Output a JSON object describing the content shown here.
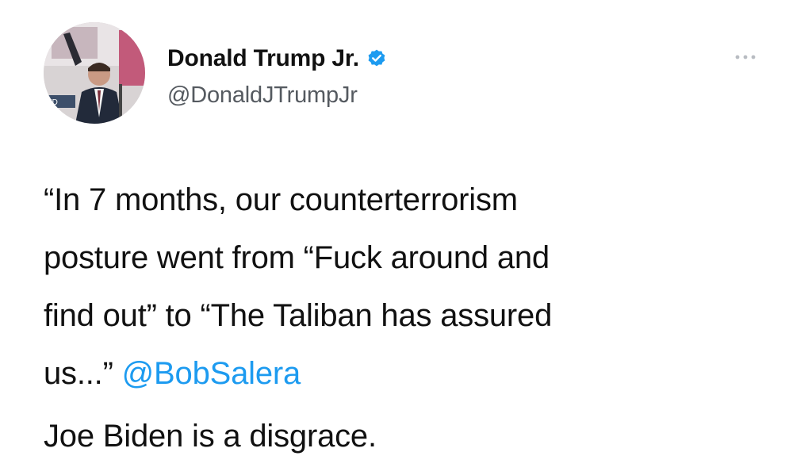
{
  "author": {
    "display_name": "Donald Trump Jr.",
    "handle": "@DonaldJTrumpJr",
    "verified": true,
    "avatar_icon": "profile-photo"
  },
  "icons": {
    "verified": "verified-badge-icon",
    "more": "more-options-icon"
  },
  "tweet": {
    "quote_lines": [
      "“In 7 months, our counterterrorism",
      "posture went from “Fuck around and",
      "find out” to “The Taliban has assured",
      "us...”"
    ],
    "mention": "@BobSalera",
    "footer": "Joe Biden is a disgrace."
  },
  "colors": {
    "mention": "#1d9bf0",
    "verified_badge": "#1d9bf0",
    "text": "#111111",
    "handle": "#555a60"
  }
}
